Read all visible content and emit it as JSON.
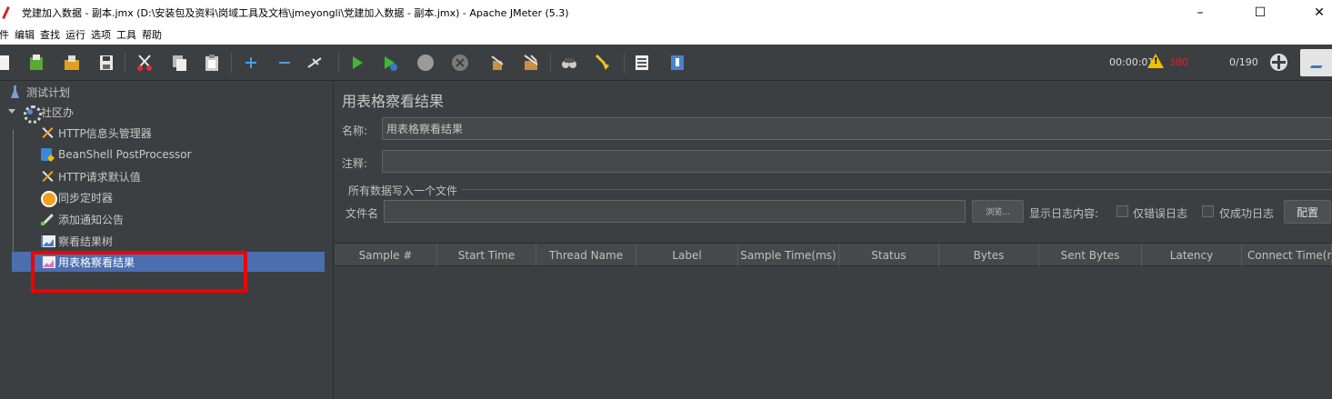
{
  "window": {
    "title": "党建加入数据 - 副本.jmx (D:\\安装包及资料\\岗域工具及文档\\jmeyongli\\党建加入数据 - 副本.jmx) - Apache JMeter (5.3)",
    "minimize": "–",
    "maximize": "☐",
    "close": "✕"
  },
  "menu": [
    "件",
    "编辑",
    "查找",
    "运行",
    "选项",
    "工具",
    "帮助"
  ],
  "status": {
    "elapsed": "00:00:01",
    "errors": "380",
    "threads": "0/190"
  },
  "tree": {
    "root": "测试计划",
    "group": "社区办",
    "children": [
      {
        "label": "HTTP信息头管理器",
        "icon": "tools-icon"
      },
      {
        "label": "BeanShell PostProcessor",
        "icon": "script-icon"
      },
      {
        "label": "HTTP请求默认值",
        "icon": "tools-icon"
      },
      {
        "label": "同步定时器",
        "icon": "timer-icon"
      },
      {
        "label": "添加通知公告",
        "icon": "brush-icon"
      },
      {
        "label": "察看结果树",
        "icon": "chart-icon"
      },
      {
        "label": "用表格察看结果",
        "icon": "chart-icon"
      }
    ]
  },
  "panel": {
    "title": "用表格察看结果",
    "name_label": "名称:",
    "name_value": "用表格察看结果",
    "comment_label": "注释:",
    "group_title": "所有数据写入一个文件",
    "filename_label": "文件名",
    "browse_label": "浏览...",
    "log_label": "显示日志内容:",
    "errors_only_label": "仅错误日志",
    "success_only_label": "仅成功日志",
    "config_label": "配置"
  },
  "table": {
    "columns": [
      "Sample #",
      "Start Time",
      "Thread Name",
      "Label",
      "Sample Time(ms)",
      "Status",
      "Bytes",
      "Sent Bytes",
      "Latency",
      "Connect Time(m..."
    ]
  },
  "colors": {
    "background": "#3c3f41",
    "selection": "#4b6eaf",
    "annotation": "#f00000",
    "error": "#e02020"
  }
}
